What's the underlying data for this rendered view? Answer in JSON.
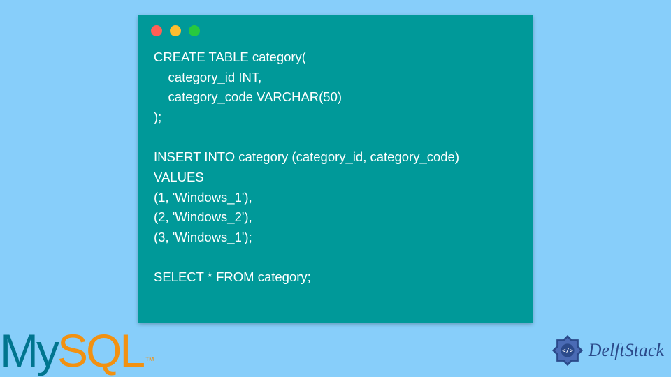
{
  "code": {
    "lines": [
      "CREATE TABLE category(",
      "    category_id INT,",
      "    category_code VARCHAR(50)",
      ");",
      "",
      "INSERT INTO category (category_id, category_code)",
      "VALUES",
      "(1, 'Windows_1'),",
      "(2, 'Windows_2'),",
      "(3, 'Windows_1');",
      "",
      "SELECT * FROM category;"
    ]
  },
  "mysql_logo": {
    "part1": "My",
    "part2": "SQL",
    "tm": "™"
  },
  "delft_logo": {
    "text": "DelftStack"
  },
  "window_controls": {
    "red": "close",
    "yellow": "minimize",
    "green": "maximize"
  }
}
